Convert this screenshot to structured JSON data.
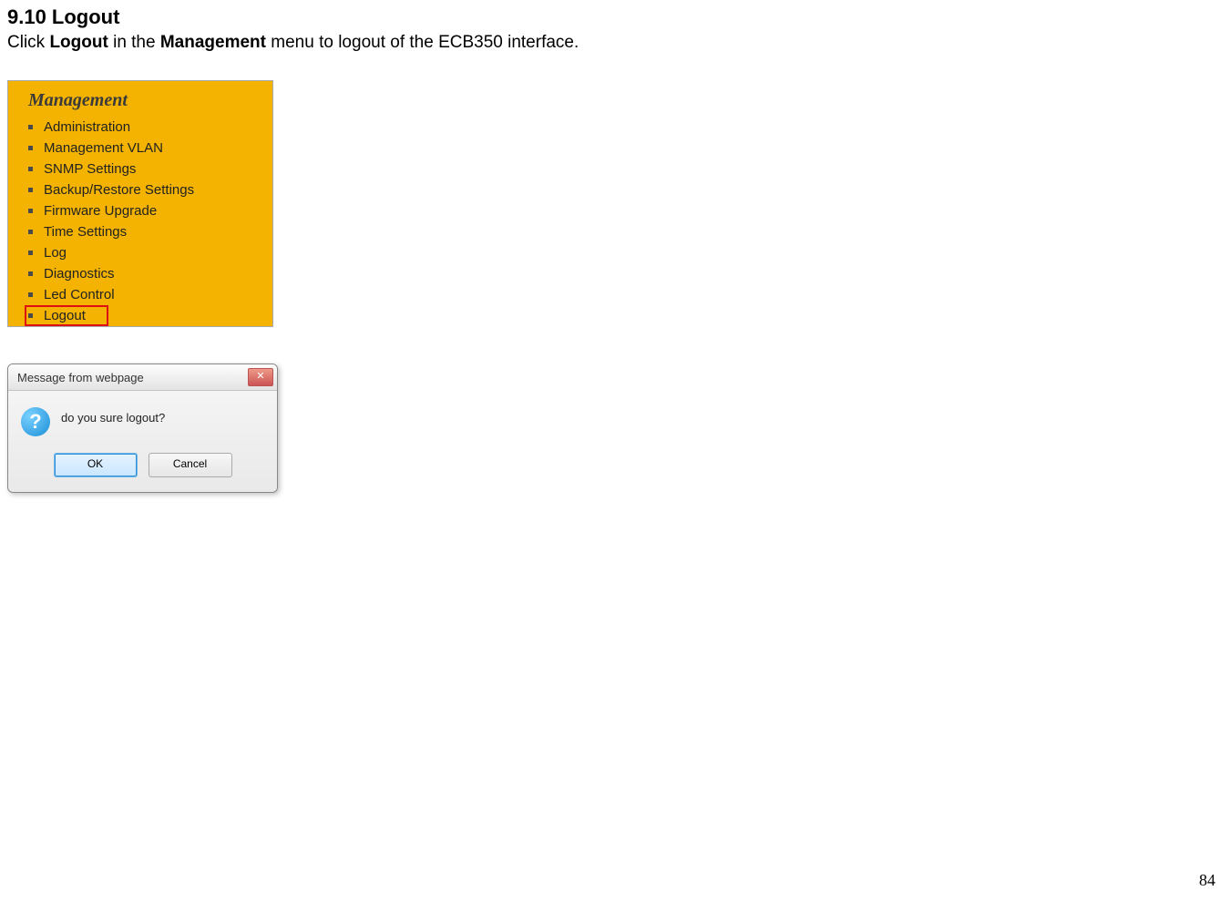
{
  "heading": "9.10 Logout",
  "body_pre": "Click ",
  "body_bold1": "Logout",
  "body_mid": " in the ",
  "body_bold2": "Management",
  "body_post": " menu to logout of the ECB350 interface.",
  "menu": {
    "title": "Management",
    "items": [
      {
        "label": "Administration",
        "highlight": false
      },
      {
        "label": "Management VLAN",
        "highlight": false
      },
      {
        "label": "SNMP Settings",
        "highlight": false
      },
      {
        "label": "Backup/Restore Settings",
        "highlight": false
      },
      {
        "label": "Firmware Upgrade",
        "highlight": false
      },
      {
        "label": "Time Settings",
        "highlight": false
      },
      {
        "label": "Log",
        "highlight": false
      },
      {
        "label": "Diagnostics",
        "highlight": false
      },
      {
        "label": "Led Control",
        "highlight": false
      },
      {
        "label": "Logout",
        "highlight": true
      }
    ]
  },
  "dialog": {
    "title": "Message from webpage",
    "close_glyph": "✕",
    "icon_glyph": "?",
    "message": "do you sure logout?",
    "ok": "OK",
    "cancel": "Cancel"
  },
  "page_number": "84"
}
